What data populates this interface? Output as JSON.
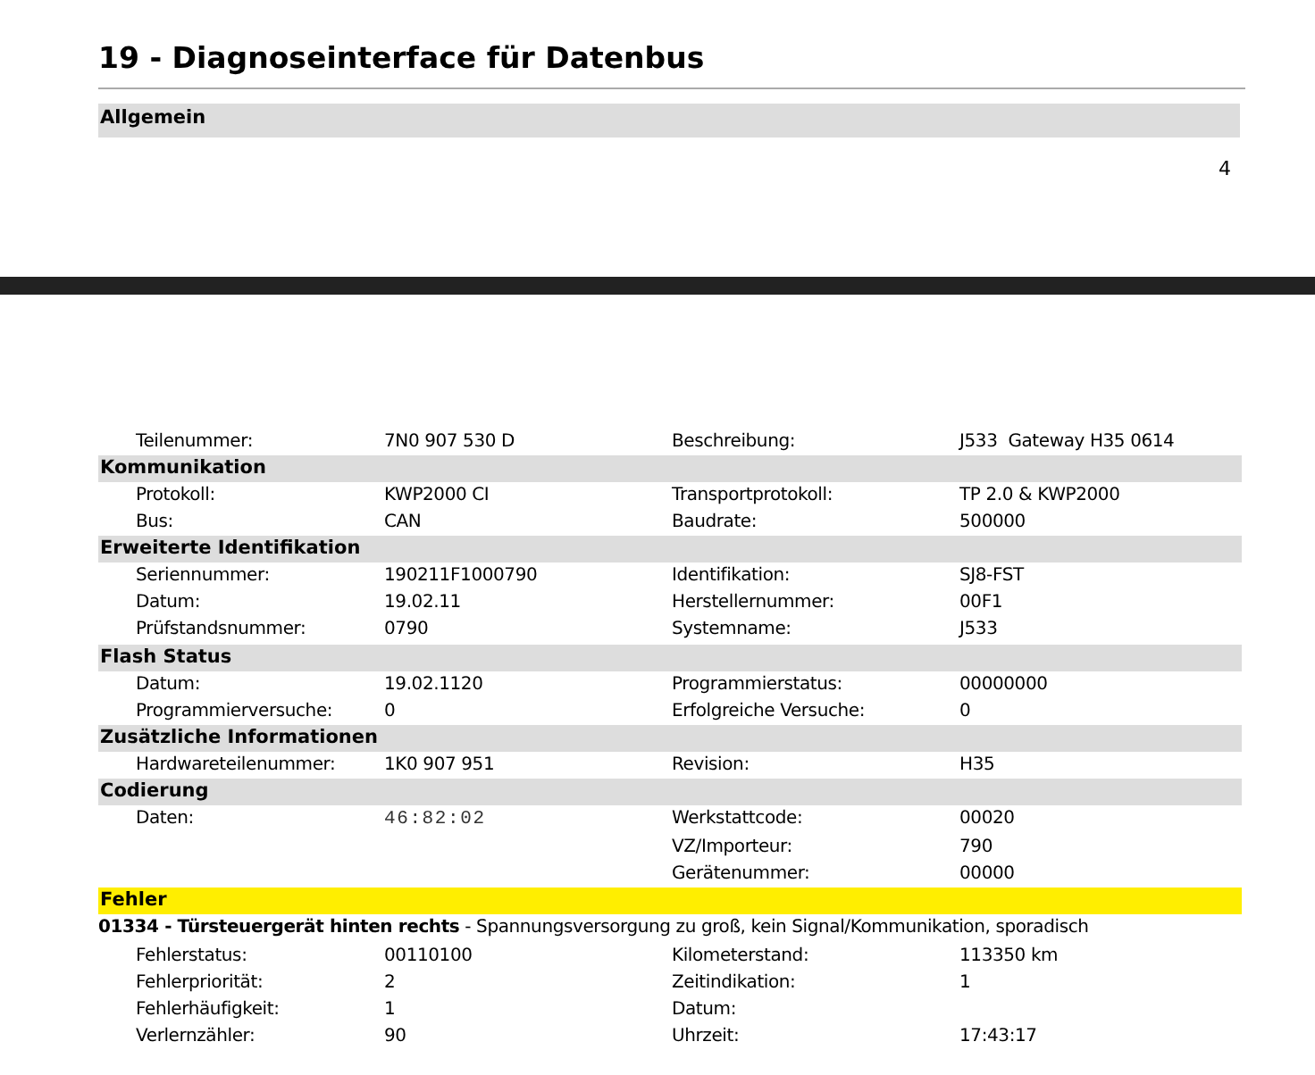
{
  "page_1": {
    "heading": "19 - Diagnoseinterface für Datenbus",
    "section": {
      "title": "Allgemein",
      "color": "#dddddd"
    },
    "page_number": "4"
  },
  "page_2": {
    "rows": [
      {
        "kind": "field",
        "label": "Teilenummer:",
        "value": "7N0 907 530 D",
        "label_2": "Beschreibung:",
        "value_2": "J533  Gateway H35 0614"
      },
      {
        "kind": "section",
        "title": "Kommunikation",
        "color": "#dddddd"
      },
      {
        "kind": "field",
        "label": "Protokoll:",
        "value": "KWP2000 CI",
        "label_2": "Transportprotokoll:",
        "value_2": "TP 2.0 & KWP2000"
      },
      {
        "kind": "field",
        "label": "Bus:",
        "value": "CAN",
        "label_2": "Baudrate:",
        "value_2": "500000"
      },
      {
        "kind": "section",
        "title": "Erweiterte Identifikation",
        "color": "#dddddd"
      },
      {
        "kind": "field",
        "label": "Seriennummer:",
        "value": "190211F1000790",
        "label_2": "Identifikation:",
        "value_2": "SJ8-FST"
      },
      {
        "kind": "field",
        "label": "Datum:",
        "value": "19.02.11",
        "label_2": "Herstellernummer:",
        "value_2": "00F1"
      },
      {
        "kind": "field",
        "label": "Prüfstandsnummer:",
        "value": "0790",
        "label_2": "Systemname:",
        "value_2": "J533"
      },
      {
        "kind": "section",
        "title": "Flash Status",
        "color": "#dddddd"
      },
      {
        "kind": "field",
        "label": "Datum:",
        "value": "19.02.1120",
        "label_2": "Programmierstatus:",
        "value_2": "00000000"
      },
      {
        "kind": "field",
        "label": "Programmierversuche:",
        "value": "0",
        "label_2": "Erfolgreiche Versuche:",
        "value_2": "0"
      },
      {
        "kind": "section",
        "title": "Zusätzliche Informationen",
        "color": "#dddddd"
      },
      {
        "kind": "field",
        "label": "Hardwareteilenummer:",
        "value": "1K0 907 951",
        "label_2": "Revision:",
        "value_2": "H35"
      },
      {
        "kind": "section",
        "title": "Codierung",
        "color": "#dddddd"
      },
      {
        "kind": "field",
        "label": "Daten:",
        "value": "46:82:02",
        "mono": true,
        "label_2": "Werkstattcode:",
        "value_2": "00020"
      },
      {
        "kind": "field",
        "label_2": "VZ/Importeur:",
        "value_2": "790"
      },
      {
        "kind": "field",
        "label_2": "Gerätenummer:",
        "value_2": "00000"
      },
      {
        "kind": "section",
        "title": "Fehler",
        "color": "#ffee00"
      },
      {
        "kind": "fault",
        "text": "**01334 - Türsteuergerät hinten rechts** - Spannungsversorgung zu groß, kein Signal/Kommunikation, sporadisch"
      },
      {
        "kind": "field",
        "label": "Fehlerstatus:",
        "value": "00110100",
        "label_2": "Kilometerstand:",
        "value_2": "113350 km"
      },
      {
        "kind": "field",
        "label": "Fehlerpriorität:",
        "value": "2",
        "label_2": "Zeitindikation:",
        "value_2": "1"
      },
      {
        "kind": "field",
        "label": "Fehlerhäufigkeit:",
        "value": "1",
        "label_2": "Datum:"
      },
      {
        "kind": "field",
        "label": "Verlernzähler:",
        "value": "90",
        "label_2": "Uhrzeit:",
        "value_2": "17:43:17"
      }
    ]
  }
}
